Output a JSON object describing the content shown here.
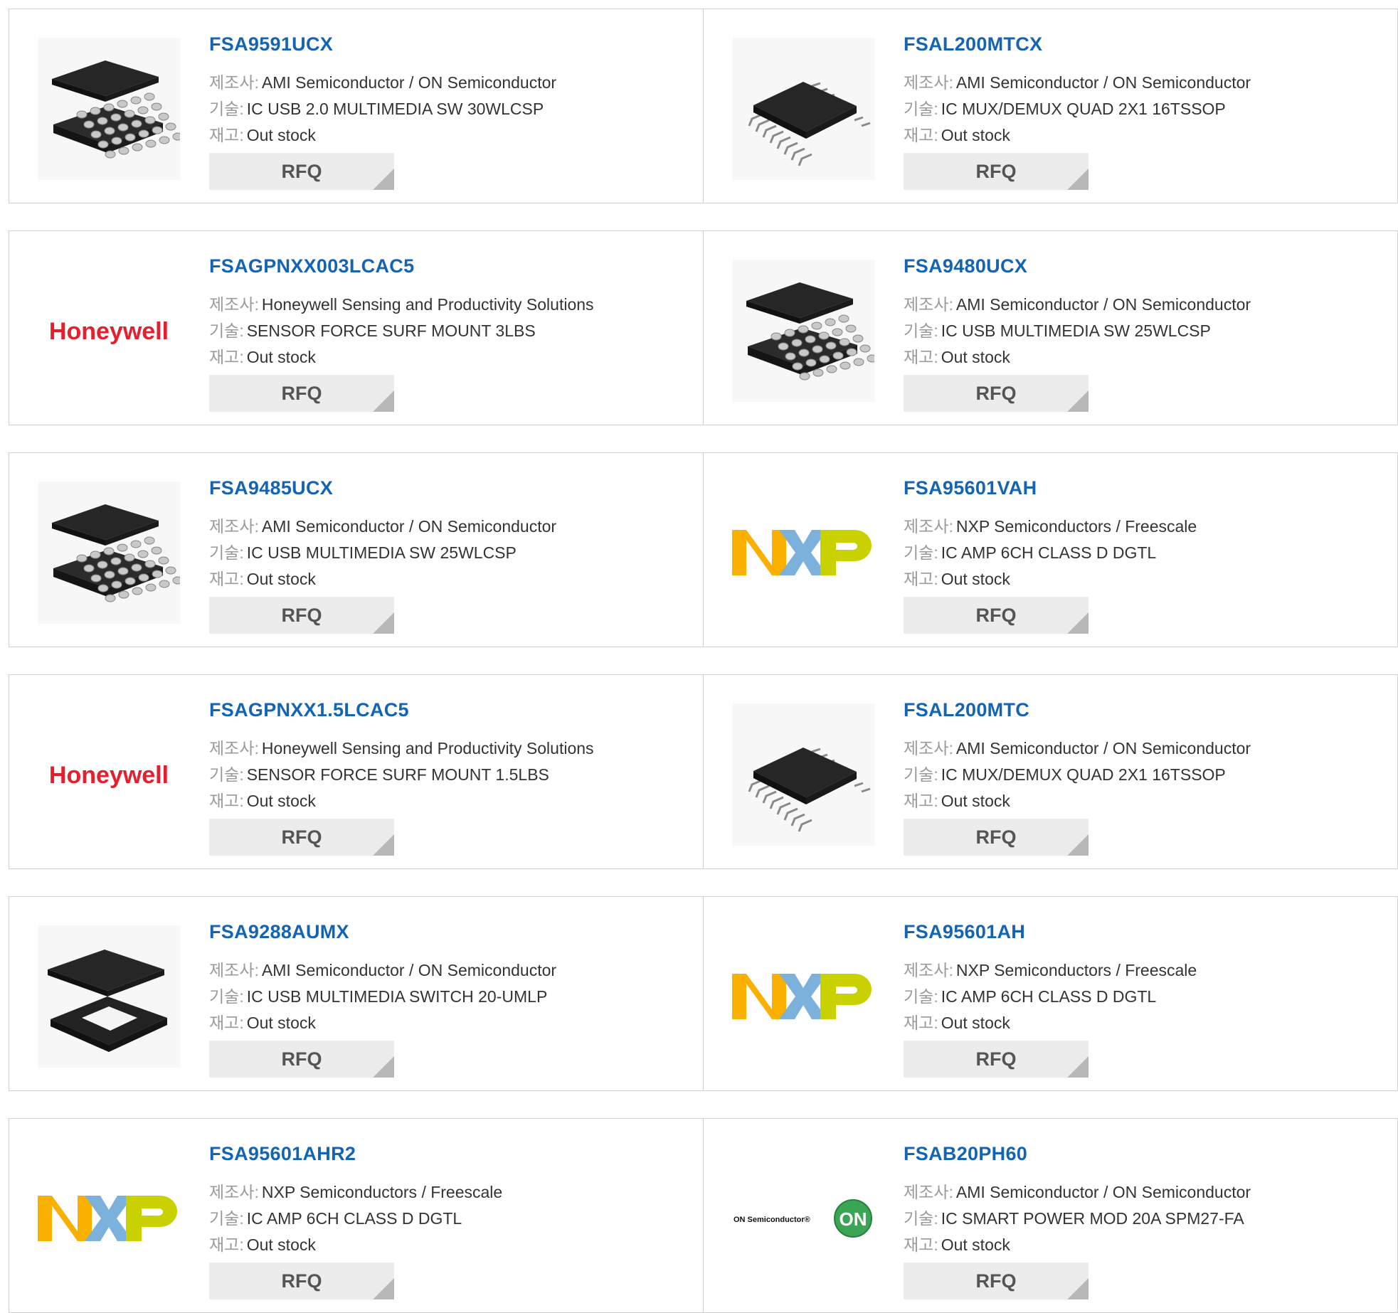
{
  "labels": {
    "manufacturer": "제조사:",
    "description": "기술:",
    "stock": "재고:"
  },
  "rfq_label": "RFQ",
  "colors": {
    "link": "#1464b4",
    "honeywell_red": "#e4202e",
    "on_green": "#3aa655"
  },
  "products": [
    {
      "part": "FSA9591UCX",
      "manufacturer": "AMI Semiconductor / ON Semiconductor",
      "description": "IC USB 2.0 MULTIMEDIA SW 30WLCSP",
      "stock": "Out stock",
      "image": "bga-chip-icon"
    },
    {
      "part": "FSAL200MTCX",
      "manufacturer": "AMI Semiconductor / ON Semiconductor",
      "description": "IC MUX/DEMUX QUAD 2X1 16TSSOP",
      "stock": "Out stock",
      "image": "tssop-chip-icon"
    },
    {
      "part": "FSAGPNXX003LCAC5",
      "manufacturer": "Honeywell Sensing and Productivity Solutions",
      "description": "SENSOR FORCE SURF MOUNT 3LBS",
      "stock": "Out stock",
      "image": "honeywell-logo",
      "logo_text": "Honeywell"
    },
    {
      "part": "FSA9480UCX",
      "manufacturer": "AMI Semiconductor / ON Semiconductor",
      "description": "IC USB MULTIMEDIA SW 25WLCSP",
      "stock": "Out stock",
      "image": "bga-chip-icon"
    },
    {
      "part": "FSA9485UCX",
      "manufacturer": "AMI Semiconductor / ON Semiconductor",
      "description": "IC USB MULTIMEDIA SW 25WLCSP",
      "stock": "Out stock",
      "image": "bga-chip-icon"
    },
    {
      "part": "FSA95601VAH",
      "manufacturer": "NXP Semiconductors / Freescale",
      "description": "IC AMP 6CH CLASS D DGTL",
      "stock": "Out stock",
      "image": "nxp-logo"
    },
    {
      "part": "FSAGPNXX1.5LCAC5",
      "manufacturer": "Honeywell Sensing and Productivity Solutions",
      "description": "SENSOR FORCE SURF MOUNT 1.5LBS",
      "stock": "Out stock",
      "image": "honeywell-logo",
      "logo_text": "Honeywell"
    },
    {
      "part": "FSAL200MTC",
      "manufacturer": "AMI Semiconductor / ON Semiconductor",
      "description": "IC MUX/DEMUX QUAD 2X1 16TSSOP",
      "stock": "Out stock",
      "image": "tssop-chip-icon"
    },
    {
      "part": "FSA9288AUMX",
      "manufacturer": "AMI Semiconductor / ON Semiconductor",
      "description": "IC USB MULTIMEDIA SWITCH 20-UMLP",
      "stock": "Out stock",
      "image": "umlp-chip-icon"
    },
    {
      "part": "FSA95601AH",
      "manufacturer": "NXP Semiconductors / Freescale",
      "description": "IC AMP 6CH CLASS D DGTL",
      "stock": "Out stock",
      "image": "nxp-logo"
    },
    {
      "part": "FSA95601AHR2",
      "manufacturer": "NXP Semiconductors / Freescale",
      "description": "IC AMP 6CH CLASS D DGTL",
      "stock": "Out stock",
      "image": "nxp-logo"
    },
    {
      "part": "FSAB20PH60",
      "manufacturer": "AMI Semiconductor / ON Semiconductor",
      "description": "IC SMART POWER MOD 20A SPM27-FA",
      "stock": "Out stock",
      "image": "on-semiconductor-logo",
      "logo_text": "ON Semiconductor®",
      "badge_text": "ON"
    }
  ]
}
